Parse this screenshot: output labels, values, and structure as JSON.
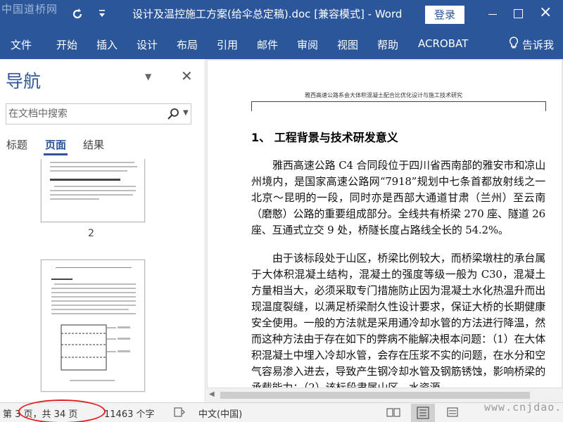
{
  "titlebar": {
    "watermark": "中国道桥网",
    "redo_icon": "redo-icon",
    "customize_icon": "customize-qat-icon",
    "doc_title": "设计及温控施工方案(给伞总定稿).doc [兼容模式] - Word",
    "login_label": "登录",
    "bg_color": "#2b579a"
  },
  "ribbon": {
    "tabs": [
      "文件",
      "开始",
      "插入",
      "设计",
      "布局",
      "引用",
      "邮件",
      "审阅",
      "视图",
      "帮助",
      "ACROBAT"
    ],
    "tell_me": "告诉我"
  },
  "nav": {
    "title": "导航",
    "search_placeholder": "在文档中搜索",
    "tabs": [
      "标题",
      "页面",
      "结果"
    ],
    "active_tab": "页面",
    "thumb_page_number": "2"
  },
  "document": {
    "running_head": "雅西高速公路系会大体积混凝土配合比优化设计与施工技术研究",
    "heading": "1、 工程背景与技术研发意义",
    "paragraphs": [
      "雅西高速公路 C4 合同段位于四川省西南部的雅安市和凉山州境内，是国家高速公路网“7918”规划中七条首都放射线之一北京～昆明的一段，同时亦是西部大通道甘肃（兰州）至云南（磨憨）公路的重要组成部分。全线共有桥梁 270 座、隧道 26 座、互通式立交 9 处，桥隧长度占路线全长的 54.2%。",
      "由于该标段处于山区，桥梁比例较大，而桥梁墩柱的承台属于大体积混凝土结构，混凝土的强度等级一般为 C30，混凝土方量相当大，必须采取专门措施防止因为混凝土水化热温升而出现温度裂缝，以满足桥梁耐久性设计要求，保证大桥的长期健康安全使用。一般的方法就是采用通冷却水管的方法进行降温，然而这种方法由于存在如下的弊病不能解决根本问题：（1）在大体积混凝土中埋入冷却水管，会存在压浆不实的问题，在水分和空气容易渗入进去，导致产生钢冷却水管及钢筋锈蚀，影响桥梁的承载能力；（2）该标段隶属山区，水资源"
    ]
  },
  "status": {
    "page_info": "第 3 页，共 34 页",
    "word_count": "11463 个字",
    "language": "中文(中国)",
    "watermark": "www.cnjdao.com",
    "annotation_color": "#e02020"
  }
}
